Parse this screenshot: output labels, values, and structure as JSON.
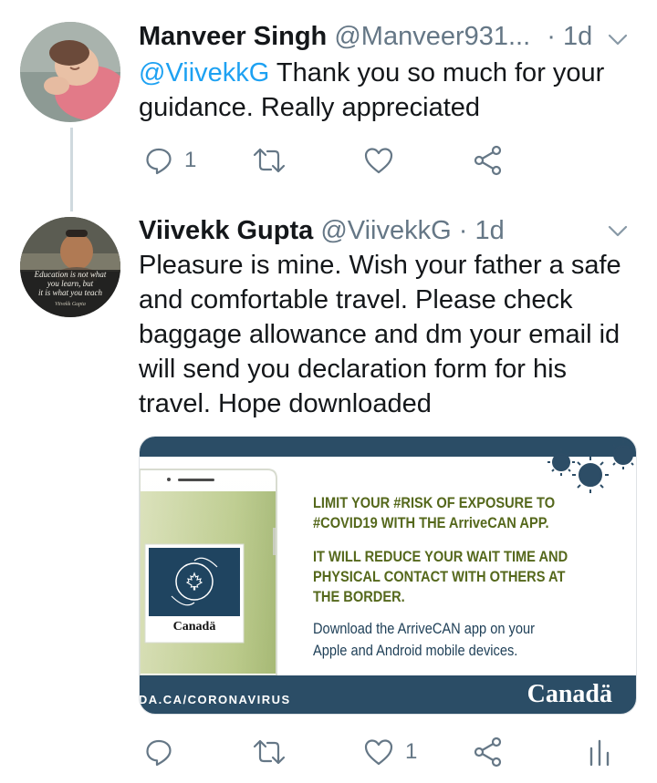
{
  "colors": {
    "link": "#1da1f2",
    "muted": "#657786",
    "dark_blue": "#2d4d66",
    "olive": "#55681c",
    "navy": "#1e3f57"
  },
  "tweet1": {
    "name": "Manveer Singh",
    "handle": "@Manveer931...",
    "time": "· 1d",
    "mention": "@ViivekkG",
    "text": " Thank you so much for your guidance. Really appreciated",
    "reply_count": "1",
    "retweet_count": "",
    "like_count": ""
  },
  "tweet2": {
    "name": "Viivekk Gupta",
    "handle": "@ViivekkG",
    "time": "· 1d",
    "text": "Pleasure is mine. Wish your father a safe and comfortable travel. Please check baggage allowance and dm your email id will send you declaration form for his travel.  Hope downloaded",
    "avatar_quote": [
      "Education is not what",
      "you learn, but",
      "it is what you teach"
    ],
    "avatar_sign": "Viivekk Gupta",
    "reply_count": "",
    "retweet_count": "",
    "like_count": "1"
  },
  "card": {
    "heading_1": "LIMIT YOUR #RISK OF EXPOSURE TO",
    "heading_2": "#COVID19 WITH THE ArriveCAN APP.",
    "body_1": "IT WILL REDUCE YOUR WAIT TIME AND",
    "body_2": "PHYSICAL CONTACT WITH OTHERS AT",
    "body_3": "THE BORDER.",
    "sub_1": "Download the ArriveCAN app on your",
    "sub_2": "Apple and Android mobile devices.",
    "app_brand": "Canadä",
    "footer_url": "ADA.CA/CORONAVIRUS",
    "footer_brand": "Canadä"
  },
  "icons": [
    "reply-icon",
    "retweet-icon",
    "like-icon",
    "share-icon",
    "analytics-icon",
    "chevron-down-icon",
    "maple-leaf-icon",
    "virus-icon"
  ]
}
